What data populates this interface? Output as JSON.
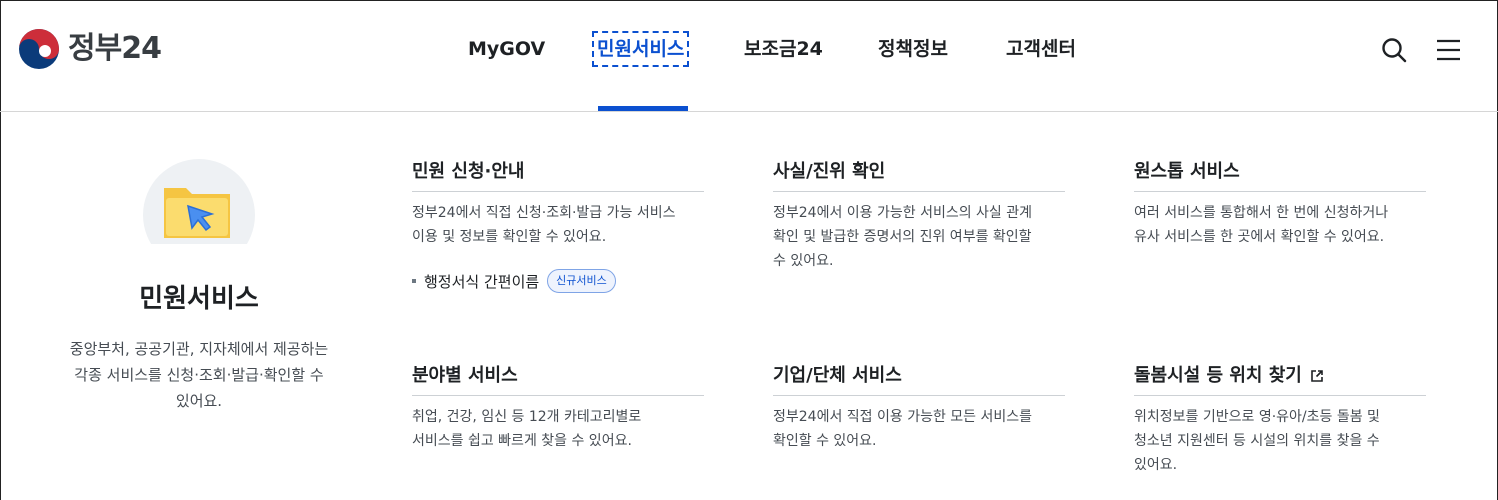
{
  "header": {
    "logo_text": "정부24",
    "nav": [
      {
        "label": "MyGOV",
        "active": false
      },
      {
        "label": "민원서비스",
        "active": true
      },
      {
        "label": "보조금24",
        "active": false
      },
      {
        "label": "정책정보",
        "active": false
      },
      {
        "label": "고객센터",
        "active": false
      }
    ],
    "icons": [
      "search-icon",
      "menu-icon"
    ]
  },
  "intro": {
    "icon": "folder-cursor-icon",
    "title": "민원서비스",
    "desc_line1": "중앙부처, 공공기관, 지자체에서 제공하는",
    "desc_line2": "각종 서비스를 신청·조회·발급·확인할 수",
    "desc_line3": "있어요."
  },
  "cards": [
    {
      "title": "민원 신청·안내",
      "desc_line1": "정부24에서 직접 신청·조회·발급 가능 서비스",
      "desc_line2": "이용 및 정보를 확인할 수 있어요.",
      "sub_link": {
        "label": "행정서식 간편이름",
        "badge": "신규서비스"
      }
    },
    {
      "title": "사실/진위 확인",
      "desc_line1": "정부24에서 이용 가능한 서비스의 사실 관계",
      "desc_line2": "확인 및 발급한 증명서의 진위 여부를 확인할",
      "desc_line3": "수 있어요."
    },
    {
      "title": "원스톱 서비스",
      "desc_line1": "여러 서비스를 통합해서 한 번에 신청하거나",
      "desc_line2": "유사 서비스를 한 곳에서 확인할 수 있어요."
    },
    {
      "title": "분야별 서비스",
      "desc_line1": "취업, 건강, 임신 등 12개 카테고리별로",
      "desc_line2": "서비스를 쉽고 빠르게 찾을 수 있어요."
    },
    {
      "title": "기업/단체 서비스",
      "desc_line1": "정부24에서 직접 이용 가능한 모든 서비스를",
      "desc_line2": "확인할 수 있어요."
    },
    {
      "title": "돌봄시설 등 위치 찾기",
      "external_icon": "external-link-icon",
      "desc_line1": "위치정보를 기반으로 영·유아/초등 돌봄 및",
      "desc_line2": "청소년 지원센터 등 시설의 위치를 찾을 수",
      "desc_line3": "있어요."
    }
  ],
  "colors": {
    "accent": "#0b50d0",
    "text": "#1e2124",
    "muted": "#464c53",
    "divider": "#cdd1d5"
  }
}
